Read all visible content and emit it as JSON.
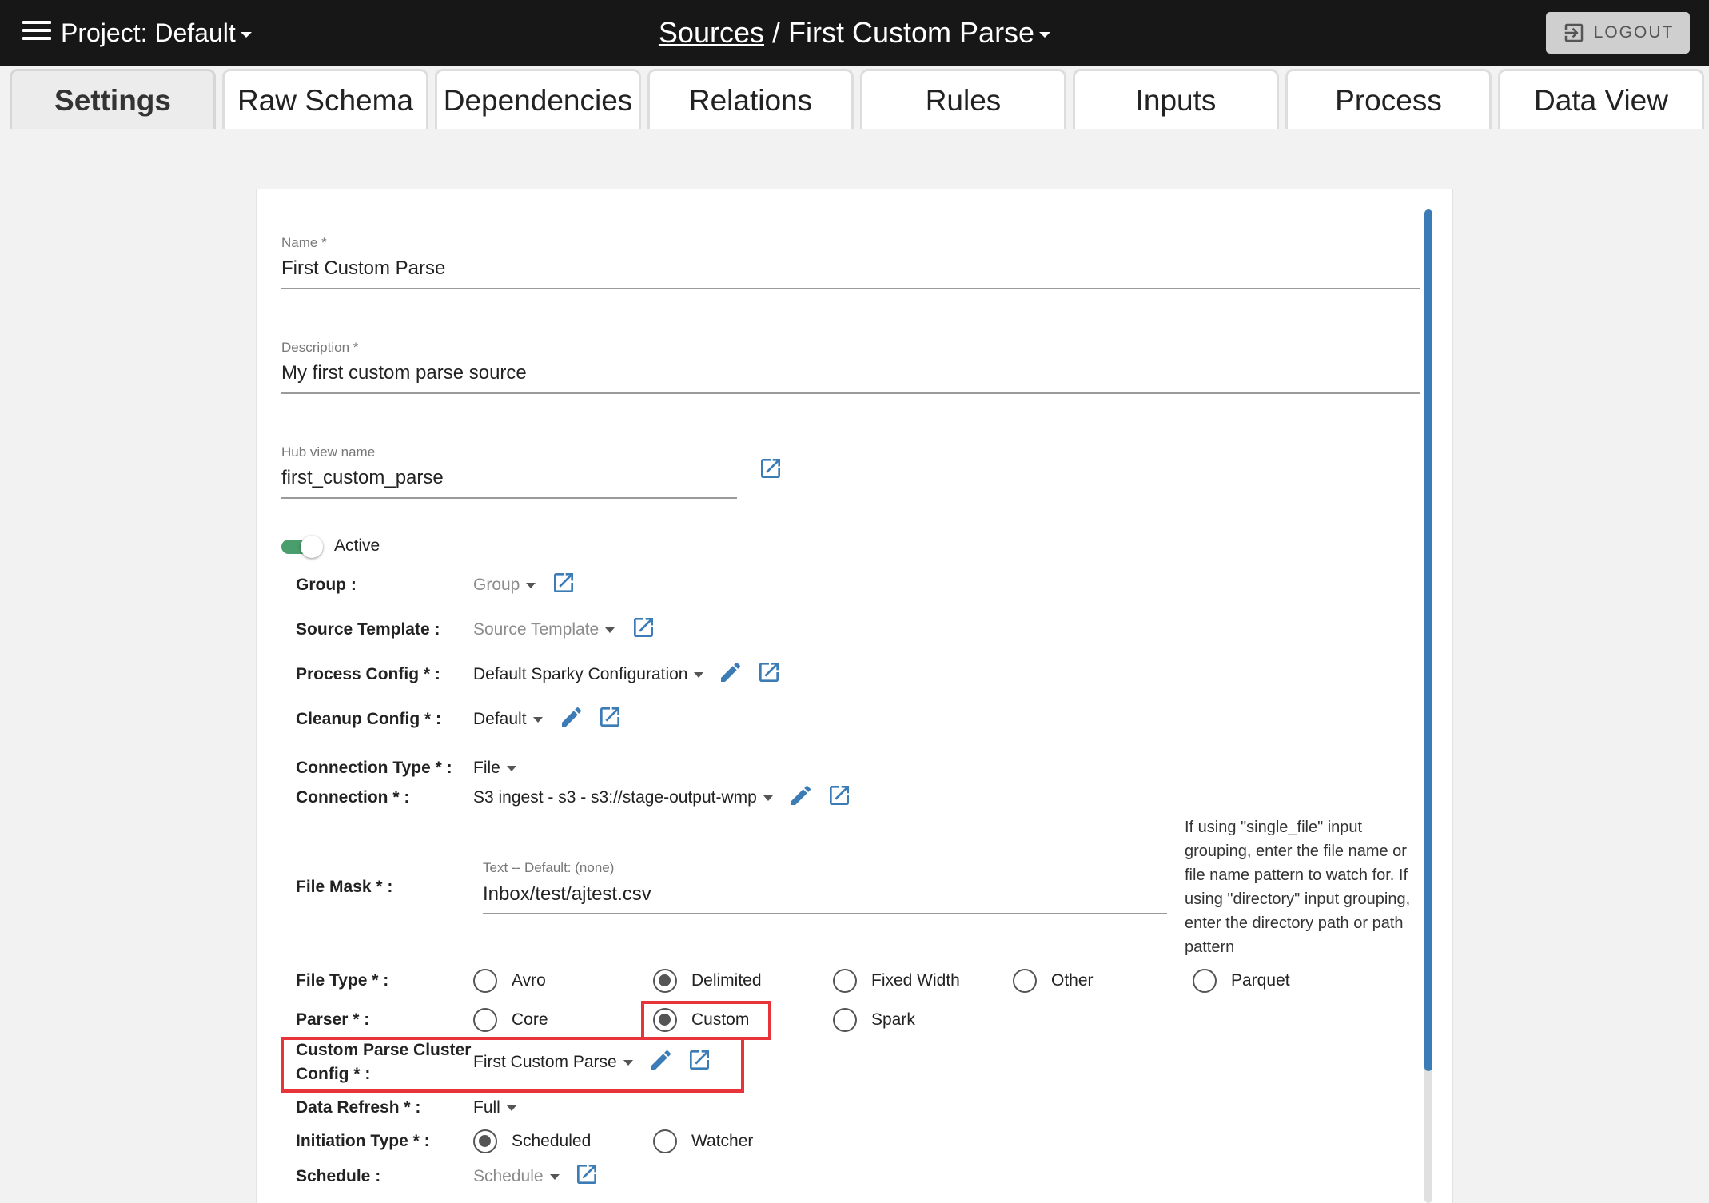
{
  "header": {
    "project_label": "Project:",
    "project_value": "Default",
    "breadcrumb_link": "Sources",
    "breadcrumb_separator": "/",
    "breadcrumb_current": "First Custom Parse",
    "logout_label": "LOGOUT"
  },
  "tabs": [
    {
      "label": "Settings",
      "active": true
    },
    {
      "label": "Raw Schema"
    },
    {
      "label": "Dependencies"
    },
    {
      "label": "Relations"
    },
    {
      "label": "Rules"
    },
    {
      "label": "Inputs"
    },
    {
      "label": "Process"
    },
    {
      "label": "Data View"
    }
  ],
  "form": {
    "name": {
      "label": "Name *",
      "value": "First Custom Parse"
    },
    "description": {
      "label": "Description *",
      "value": "My first custom parse source"
    },
    "hub_view_name": {
      "label": "Hub view name",
      "value": "first_custom_parse"
    },
    "active": {
      "label": "Active",
      "on": true
    },
    "group": {
      "label": "Group :",
      "placeholder": "Group"
    },
    "source_template": {
      "label": "Source Template :",
      "placeholder": "Source Template"
    },
    "process_config": {
      "label": "Process Config * :",
      "value": "Default Sparky Configuration"
    },
    "cleanup_config": {
      "label": "Cleanup Config * :",
      "value": "Default"
    },
    "connection_type": {
      "label": "Connection Type * :",
      "value": "File"
    },
    "connection": {
      "label": "Connection * :",
      "value": "S3 ingest - s3 - s3://stage-output-wmp"
    },
    "file_mask": {
      "label": "File Mask * :",
      "hint": "Text -- Default: (none)",
      "value": "Inbox/test/ajtest.csv",
      "help": "If using \"single_file\" input grouping, enter the file name or file name pattern to watch for. If using \"directory\" input grouping, enter the directory path or path pattern"
    },
    "file_type": {
      "label": "File Type * :",
      "options": [
        "Avro",
        "Delimited",
        "Fixed Width",
        "Other",
        "Parquet"
      ],
      "selected": "Delimited"
    },
    "parser": {
      "label": "Parser * :",
      "options": [
        "Core",
        "Custom",
        "Spark"
      ],
      "selected": "Custom"
    },
    "custom_parse_cluster_config": {
      "label_line1": "Custom Parse Cluster",
      "label_line2": "Config * :",
      "value": "First Custom Parse"
    },
    "data_refresh": {
      "label": "Data Refresh * :",
      "value": "Full"
    },
    "initiation_type": {
      "label": "Initiation Type * :",
      "options": [
        "Scheduled",
        "Watcher"
      ],
      "selected": "Scheduled"
    },
    "schedule": {
      "label": "Schedule :",
      "placeholder": "Schedule"
    }
  },
  "colors": {
    "topbar": "#171717",
    "accent_blue": "#3c7cb6",
    "toggle_green": "#4a9d6c",
    "highlight_red": "#e8333a"
  },
  "icons": [
    "menu-icon",
    "logout-icon",
    "external-link-icon",
    "edit-pencil-icon",
    "chevron-down-icon"
  ]
}
